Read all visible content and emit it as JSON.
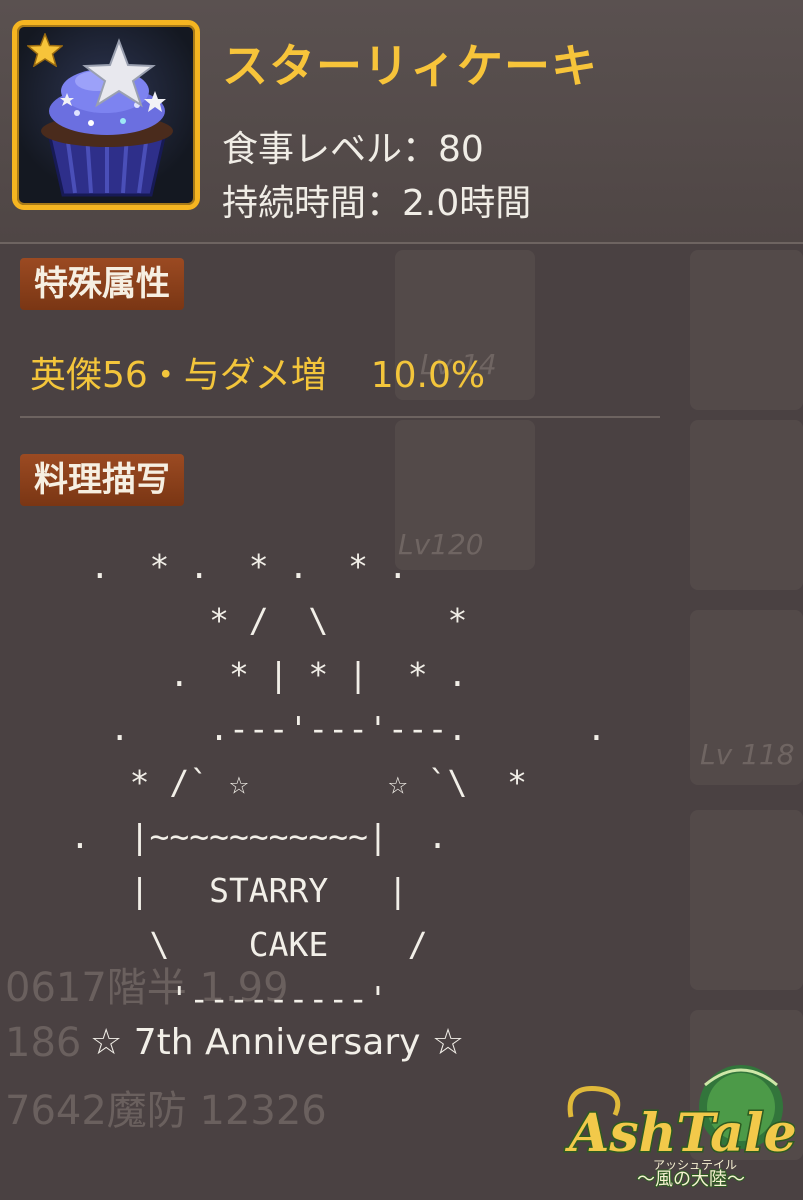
{
  "item": {
    "name": "スターリィケーキ",
    "meal_level_label": "食事レベル：80",
    "duration_label": "持続時間：2.0時間",
    "rarity_stars": 1,
    "frame_color": "#f5b521"
  },
  "sections": {
    "special_attributes": {
      "title": "特殊属性",
      "attribute_name": "英傑56・与ダメ増",
      "attribute_value": "10.0%"
    },
    "description": {
      "title": "料理描写",
      "ascii_art": [
        " .  * .  * .  * .",
        "       * /  \\      *",
        "     .  * | * |  * .",
        "  .    .---'---'---.      .",
        "   * /` ☆       ☆ `\\  *",
        ".  |~~~~~~~~~~~|  .",
        "   |   STARRY   |",
        "    \\    CAKE    /",
        "     '---------'"
      ],
      "footer": "☆ 7th Anniversary ☆"
    }
  },
  "logo": {
    "title": "AshTale",
    "subtitle": "〜風の大陸〜",
    "furigana": "アッシュテイル"
  },
  "background": {
    "lv_labels": [
      "Lv 14",
      "Lv120",
      "Lv 118"
    ],
    "text_lines": [
      "0617階半 1.99",
      "186",
      "7642魔防 12326"
    ]
  },
  "colors": {
    "accent": "#f7c43a",
    "section_label_bg": "#8a4019",
    "panel_bg": "#4a4142"
  }
}
